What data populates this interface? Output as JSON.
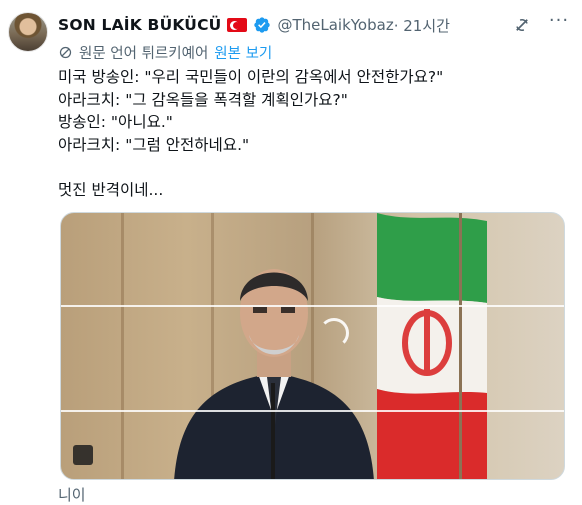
{
  "author": {
    "name": "SON LAİK BÜKÜCÜ",
    "handle": "@TheLaikYobaz",
    "time": " · 21시간"
  },
  "icons": {
    "avatar": "profile-photo",
    "flag": "turkey-flag",
    "verified": "verified-badge-icon",
    "grok": "grok-icon",
    "more": "more-icon",
    "translate": "translate-icon"
  },
  "translation": {
    "note": "원문 언어 튀르키예어",
    "link": "원본 보기"
  },
  "tweet": {
    "lines": [
      "미국 방송인: \"우리 국민들이 이란의 감옥에서 안전한가요?\"",
      "아라크치: \"그 감옥들을 폭격할 계획인가요?\"",
      "방송인: \"아니요.\"",
      "아라크치: \"그럼 안전하네요.\"",
      "",
      "멋진 반격이네..."
    ]
  },
  "footer": {
    "partial_text": "니이"
  },
  "colors": {
    "link": "#1d9bf0",
    "muted": "#536471",
    "text": "#0f1419",
    "flag_red": "#e30a17",
    "verified": "#1d9bf0"
  }
}
